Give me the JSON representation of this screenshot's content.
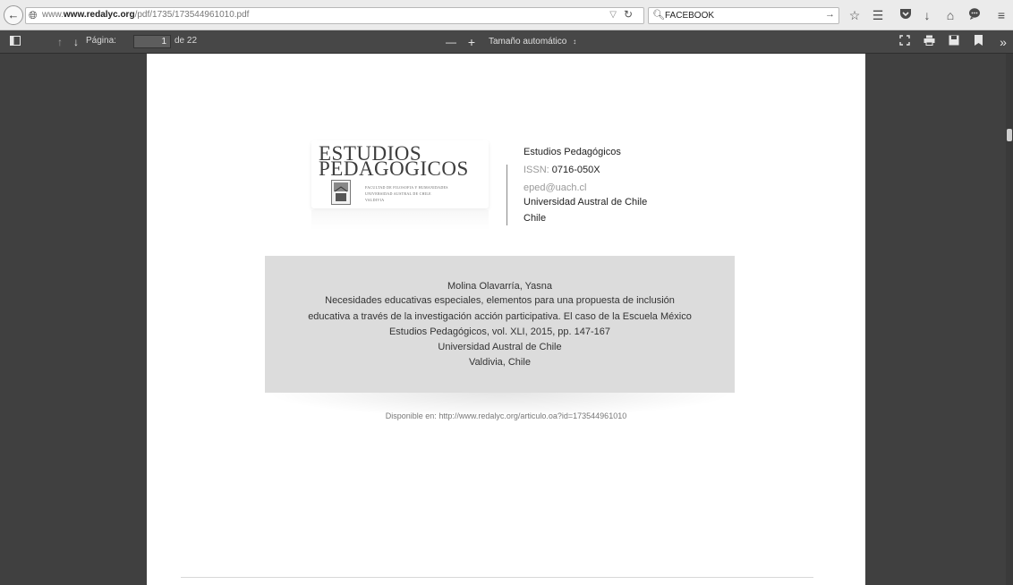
{
  "browser": {
    "url_domain": "www.redalyc.org",
    "url_path": "/pdf/1735/173544961010.pdf",
    "url_prefix": "www.",
    "search_text": "FACEBOOK"
  },
  "toolbar": {
    "page_label": "Página:",
    "page_number": "1",
    "page_count": "de 22",
    "zoom_label": "Tamaño automático",
    "zoom_minus": "—",
    "zoom_plus": "+"
  },
  "journal": {
    "logo_line1": "ESTUDIOS",
    "logo_line2": "PEDAGOGICOS",
    "logo_sub1": "FACULTAD DE FILOSOFIA Y HUMANIDADES",
    "logo_sub2": "UNIVERSIDAD AUSTRAL DE CHILE",
    "logo_sub3": "VALDIVIA",
    "name": "Estudios Pedagógicos",
    "issn_label": "ISSN:",
    "issn": "0716-050X",
    "email": "eped@uach.cl",
    "institution": "Universidad Austral de Chile",
    "country": "Chile"
  },
  "citation": {
    "author": "Molina Olavarría, Yasna",
    "title_line1": "Necesidades educativas especiales, elementos para una propuesta de inclusión",
    "title_line2": "educativa a través de la investigación acción participativa. El caso de la Escuela México",
    "source": "Estudios Pedagógicos, vol. XLI, 2015, pp. 147-167",
    "institution": "Universidad Austral de Chile",
    "location": "Valdivia, Chile"
  },
  "available_text": "Disponible en: http://www.redalyc.org/articulo.oa?id=173544961010"
}
